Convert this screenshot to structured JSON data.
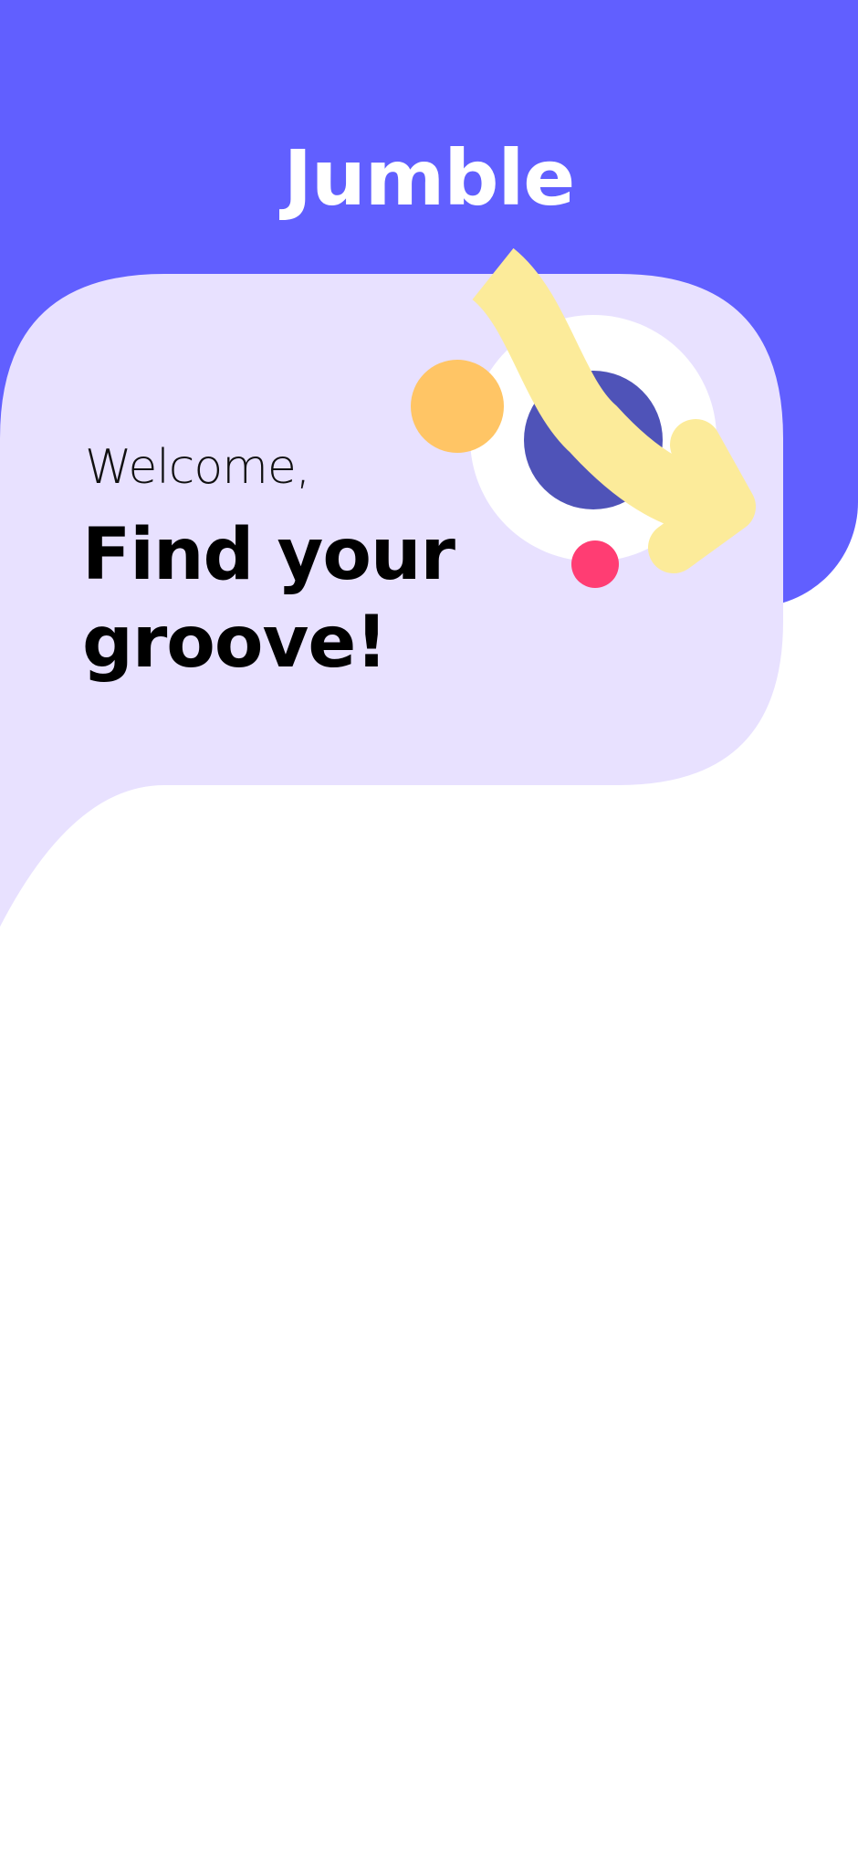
{
  "app": {
    "brand_name": "Jumble"
  },
  "hero": {
    "greeting": "Welcome,",
    "headline": "Find your groove!"
  },
  "colors": {
    "brand_blue": "#615FFF",
    "card_lavender": "#E8E1FF",
    "art_circle_white": "#FFFFFF",
    "art_circle_indigo": "#4F53B8",
    "art_dot_orange": "#FFC565",
    "art_dot_pink": "#FF3D73",
    "art_arrow_yellow": "#FCEB9A",
    "text_dark": "#000000"
  },
  "icons": {
    "hero_illustration": "abstract-arrow-circles-illustration"
  }
}
